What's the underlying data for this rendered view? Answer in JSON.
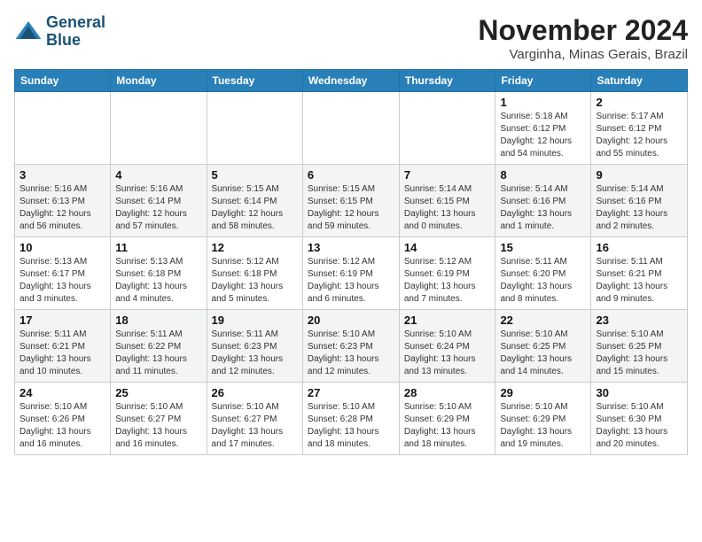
{
  "header": {
    "logo_line1": "General",
    "logo_line2": "Blue",
    "month_year": "November 2024",
    "location": "Varginha, Minas Gerais, Brazil"
  },
  "days_of_week": [
    "Sunday",
    "Monday",
    "Tuesday",
    "Wednesday",
    "Thursday",
    "Friday",
    "Saturday"
  ],
  "weeks": [
    [
      {
        "day": "",
        "info": ""
      },
      {
        "day": "",
        "info": ""
      },
      {
        "day": "",
        "info": ""
      },
      {
        "day": "",
        "info": ""
      },
      {
        "day": "",
        "info": ""
      },
      {
        "day": "1",
        "info": "Sunrise: 5:18 AM\nSunset: 6:12 PM\nDaylight: 12 hours\nand 54 minutes."
      },
      {
        "day": "2",
        "info": "Sunrise: 5:17 AM\nSunset: 6:12 PM\nDaylight: 12 hours\nand 55 minutes."
      }
    ],
    [
      {
        "day": "3",
        "info": "Sunrise: 5:16 AM\nSunset: 6:13 PM\nDaylight: 12 hours\nand 56 minutes."
      },
      {
        "day": "4",
        "info": "Sunrise: 5:16 AM\nSunset: 6:14 PM\nDaylight: 12 hours\nand 57 minutes."
      },
      {
        "day": "5",
        "info": "Sunrise: 5:15 AM\nSunset: 6:14 PM\nDaylight: 12 hours\nand 58 minutes."
      },
      {
        "day": "6",
        "info": "Sunrise: 5:15 AM\nSunset: 6:15 PM\nDaylight: 12 hours\nand 59 minutes."
      },
      {
        "day": "7",
        "info": "Sunrise: 5:14 AM\nSunset: 6:15 PM\nDaylight: 13 hours\nand 0 minutes."
      },
      {
        "day": "8",
        "info": "Sunrise: 5:14 AM\nSunset: 6:16 PM\nDaylight: 13 hours\nand 1 minute."
      },
      {
        "day": "9",
        "info": "Sunrise: 5:14 AM\nSunset: 6:16 PM\nDaylight: 13 hours\nand 2 minutes."
      }
    ],
    [
      {
        "day": "10",
        "info": "Sunrise: 5:13 AM\nSunset: 6:17 PM\nDaylight: 13 hours\nand 3 minutes."
      },
      {
        "day": "11",
        "info": "Sunrise: 5:13 AM\nSunset: 6:18 PM\nDaylight: 13 hours\nand 4 minutes."
      },
      {
        "day": "12",
        "info": "Sunrise: 5:12 AM\nSunset: 6:18 PM\nDaylight: 13 hours\nand 5 minutes."
      },
      {
        "day": "13",
        "info": "Sunrise: 5:12 AM\nSunset: 6:19 PM\nDaylight: 13 hours\nand 6 minutes."
      },
      {
        "day": "14",
        "info": "Sunrise: 5:12 AM\nSunset: 6:19 PM\nDaylight: 13 hours\nand 7 minutes."
      },
      {
        "day": "15",
        "info": "Sunrise: 5:11 AM\nSunset: 6:20 PM\nDaylight: 13 hours\nand 8 minutes."
      },
      {
        "day": "16",
        "info": "Sunrise: 5:11 AM\nSunset: 6:21 PM\nDaylight: 13 hours\nand 9 minutes."
      }
    ],
    [
      {
        "day": "17",
        "info": "Sunrise: 5:11 AM\nSunset: 6:21 PM\nDaylight: 13 hours\nand 10 minutes."
      },
      {
        "day": "18",
        "info": "Sunrise: 5:11 AM\nSunset: 6:22 PM\nDaylight: 13 hours\nand 11 minutes."
      },
      {
        "day": "19",
        "info": "Sunrise: 5:11 AM\nSunset: 6:23 PM\nDaylight: 13 hours\nand 12 minutes."
      },
      {
        "day": "20",
        "info": "Sunrise: 5:10 AM\nSunset: 6:23 PM\nDaylight: 13 hours\nand 12 minutes."
      },
      {
        "day": "21",
        "info": "Sunrise: 5:10 AM\nSunset: 6:24 PM\nDaylight: 13 hours\nand 13 minutes."
      },
      {
        "day": "22",
        "info": "Sunrise: 5:10 AM\nSunset: 6:25 PM\nDaylight: 13 hours\nand 14 minutes."
      },
      {
        "day": "23",
        "info": "Sunrise: 5:10 AM\nSunset: 6:25 PM\nDaylight: 13 hours\nand 15 minutes."
      }
    ],
    [
      {
        "day": "24",
        "info": "Sunrise: 5:10 AM\nSunset: 6:26 PM\nDaylight: 13 hours\nand 16 minutes."
      },
      {
        "day": "25",
        "info": "Sunrise: 5:10 AM\nSunset: 6:27 PM\nDaylight: 13 hours\nand 16 minutes."
      },
      {
        "day": "26",
        "info": "Sunrise: 5:10 AM\nSunset: 6:27 PM\nDaylight: 13 hours\nand 17 minutes."
      },
      {
        "day": "27",
        "info": "Sunrise: 5:10 AM\nSunset: 6:28 PM\nDaylight: 13 hours\nand 18 minutes."
      },
      {
        "day": "28",
        "info": "Sunrise: 5:10 AM\nSunset: 6:29 PM\nDaylight: 13 hours\nand 18 minutes."
      },
      {
        "day": "29",
        "info": "Sunrise: 5:10 AM\nSunset: 6:29 PM\nDaylight: 13 hours\nand 19 minutes."
      },
      {
        "day": "30",
        "info": "Sunrise: 5:10 AM\nSunset: 6:30 PM\nDaylight: 13 hours\nand 20 minutes."
      }
    ]
  ]
}
